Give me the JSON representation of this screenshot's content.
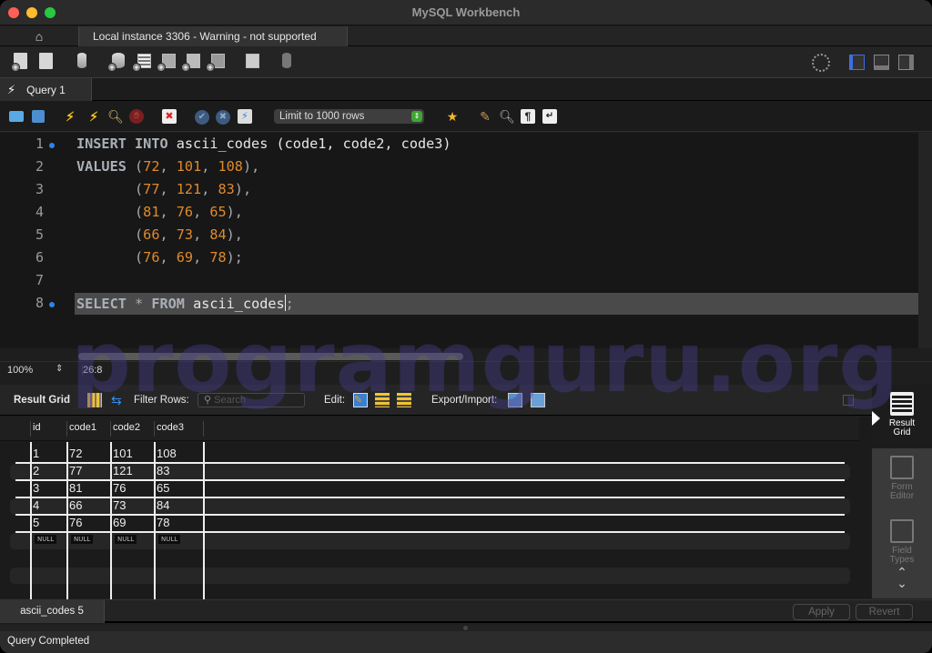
{
  "window": {
    "title": "MySQL Workbench"
  },
  "connection_tabs": {
    "home_icon": "home-icon",
    "active_tab": "Local instance 3306 - Warning - not supported"
  },
  "main_toolbar": {
    "items": [
      "new-sql-tab",
      "open-sql-script",
      "schema-inspector",
      "create-schema",
      "create-table",
      "create-view",
      "create-procedure",
      "create-function",
      "search-table-data",
      "reconnect"
    ],
    "right_icons": [
      "preferences-gear",
      "toggle-sidebar",
      "toggle-output",
      "toggle-secondary-sidebar"
    ]
  },
  "query_tabs": [
    {
      "label": "Query 1",
      "active": true
    }
  ],
  "editor_toolbar": {
    "limit_select": "Limit to 1000 rows"
  },
  "editor": {
    "lines": [
      {
        "n": "1",
        "marker": true
      },
      {
        "n": "2",
        "marker": false
      },
      {
        "n": "3",
        "marker": false
      },
      {
        "n": "4",
        "marker": false
      },
      {
        "n": "5",
        "marker": false
      },
      {
        "n": "6",
        "marker": false
      },
      {
        "n": "7",
        "marker": false
      },
      {
        "n": "8",
        "marker": true
      }
    ],
    "code": {
      "l1": {
        "kw1": "INSERT",
        "kw2": "INTO",
        "table": "ascii_codes",
        "cols": "(code1, code2, code3)"
      },
      "l2": {
        "kw": "VALUES",
        "v": [
          "72",
          "101",
          "108"
        ]
      },
      "l3": {
        "v": [
          "77",
          "121",
          "83"
        ]
      },
      "l4": {
        "v": [
          "81",
          "76",
          "65"
        ]
      },
      "l5": {
        "v": [
          "66",
          "73",
          "84"
        ]
      },
      "l6": {
        "v": [
          "76",
          "69",
          "78"
        ]
      },
      "l8": {
        "kw1": "SELECT",
        "star": "*",
        "kw2": "FROM",
        "table": "ascii_codes",
        "semi": ";"
      }
    },
    "zoom": "100%",
    "cursor_pos": "26:8"
  },
  "result_toolbar": {
    "title": "Result Grid",
    "filter_label": "Filter Rows:",
    "search_placeholder": "Search",
    "edit_label": "Edit:",
    "export_label": "Export/Import:"
  },
  "result_grid": {
    "columns": [
      "id",
      "code1",
      "code2",
      "code3"
    ],
    "rows": [
      [
        "1",
        "72",
        "101",
        "108"
      ],
      [
        "2",
        "77",
        "121",
        "83"
      ],
      [
        "3",
        "81",
        "76",
        "65"
      ],
      [
        "4",
        "66",
        "73",
        "84"
      ],
      [
        "5",
        "76",
        "69",
        "78"
      ]
    ],
    "null_label": "NULL"
  },
  "side_panel": {
    "items": [
      {
        "label1": "Result",
        "label2": "Grid",
        "active": true
      },
      {
        "label1": "Form",
        "label2": "Editor",
        "active": false
      },
      {
        "label1": "Field",
        "label2": "Types",
        "active": false
      }
    ]
  },
  "bottom": {
    "result_tab": "ascii_codes 5",
    "apply": "Apply",
    "revert": "Revert",
    "status": "Query Completed"
  },
  "watermark": "programguru.org",
  "colors": {
    "accent": "#2a86e8",
    "number": "#e08a2a",
    "keyword": "#aab0b8"
  }
}
